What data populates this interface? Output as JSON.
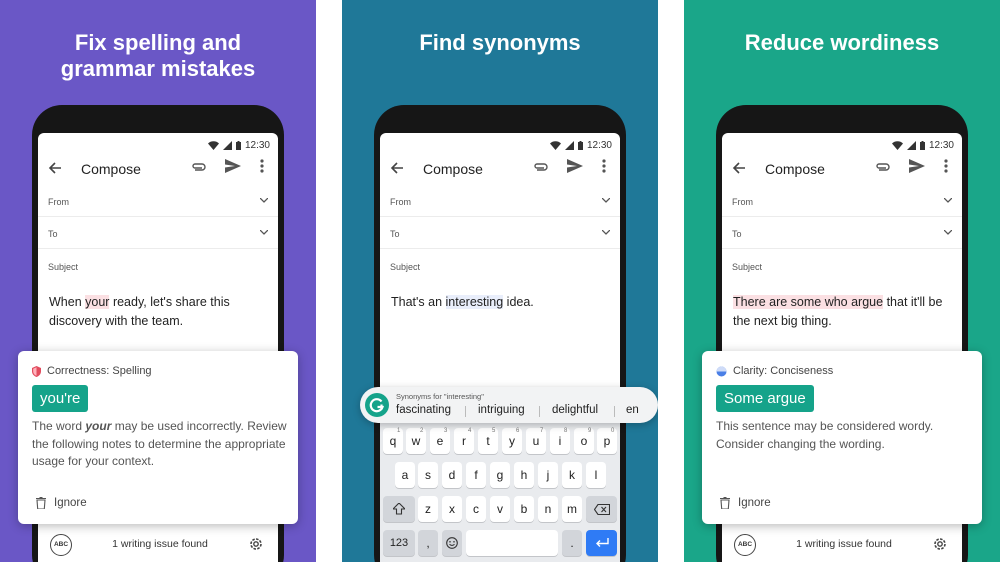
{
  "colors": {
    "panel1": "#6a57c6",
    "panel2": "#1f7898",
    "panel3": "#1aa689",
    "suggestion": "#15a38a",
    "enter_key": "#2f7bf5",
    "highlight_red": "#fbe0e3"
  },
  "status_time": "12:30",
  "compose_title": "Compose",
  "fields": {
    "from": "From",
    "to": "To",
    "subject": "Subject"
  },
  "panels": [
    {
      "headline": "Fix spelling and\ngrammar mistakes",
      "body_before": "When ",
      "body_highlight": "your",
      "body_after": " ready, let's share this discovery with the team.",
      "card": {
        "category": "Correctness: Spelling",
        "category_icon": "shield-icon",
        "suggestion": "you're",
        "desc_before": "The word ",
        "desc_emph": "your",
        "desc_after": " may be used incorrectly. Review the following notes to determine the appropriate usage for your context.",
        "ignore": "Ignore"
      },
      "footer": {
        "abc": "ABC",
        "count": "1 writing issue found"
      }
    },
    {
      "headline": "Find synonyms",
      "body_before": "That's an ",
      "body_highlight": "interesting",
      "body_after": " idea.",
      "synonyms": {
        "label": "Synonyms for \"interesting\"",
        "items": [
          "fascinating",
          "intriguing",
          "delightful",
          "en"
        ]
      },
      "keyboard": {
        "row1": [
          "q",
          "w",
          "e",
          "r",
          "t",
          "y",
          "u",
          "i",
          "o",
          "p"
        ],
        "row1_digits": [
          "1",
          "2",
          "3",
          "4",
          "5",
          "6",
          "7",
          "8",
          "9",
          "0"
        ],
        "row2": [
          "a",
          "s",
          "d",
          "f",
          "g",
          "h",
          "j",
          "k",
          "l"
        ],
        "row3": [
          "z",
          "x",
          "c",
          "v",
          "b",
          "n",
          "m"
        ],
        "num_key": "123",
        "comma": ",",
        "period": "."
      }
    },
    {
      "headline": "Reduce wordiness",
      "body_highlight": "There are some who argue",
      "body_after": " that it'll be the next big thing.",
      "card": {
        "category": "Clarity: Conciseness",
        "category_icon": "clarity-drop-icon",
        "suggestion": "Some argue",
        "desc": "This sentence may be considered wordy. Consider changing the wording.",
        "ignore": "Ignore"
      },
      "footer": {
        "abc": "ABC",
        "count": "1 writing issue found"
      }
    }
  ]
}
